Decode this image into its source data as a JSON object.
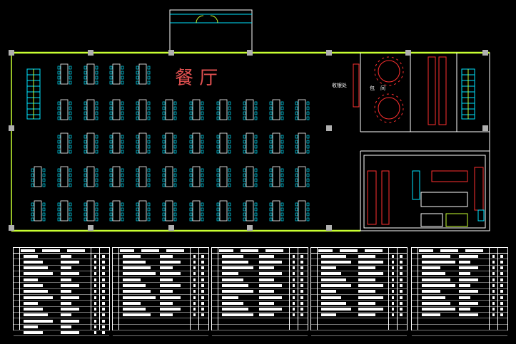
{
  "drawing": {
    "room_title": "餐   厅",
    "cashier_label": "收银处",
    "room_labels": [
      "包",
      "间"
    ]
  },
  "colors": {
    "background": "#000000",
    "wall": "#ffffff",
    "partition": "#c8ff32",
    "furniture": "#00e5ff",
    "kitchen_equipment": "#ff3030",
    "column": "#b0b0b0",
    "title": "#e05050"
  },
  "schedule_tables": [
    {
      "rows": 14
    },
    {
      "rows": 14
    },
    {
      "rows": 14
    },
    {
      "rows": 14
    },
    {
      "rows": 14
    }
  ]
}
